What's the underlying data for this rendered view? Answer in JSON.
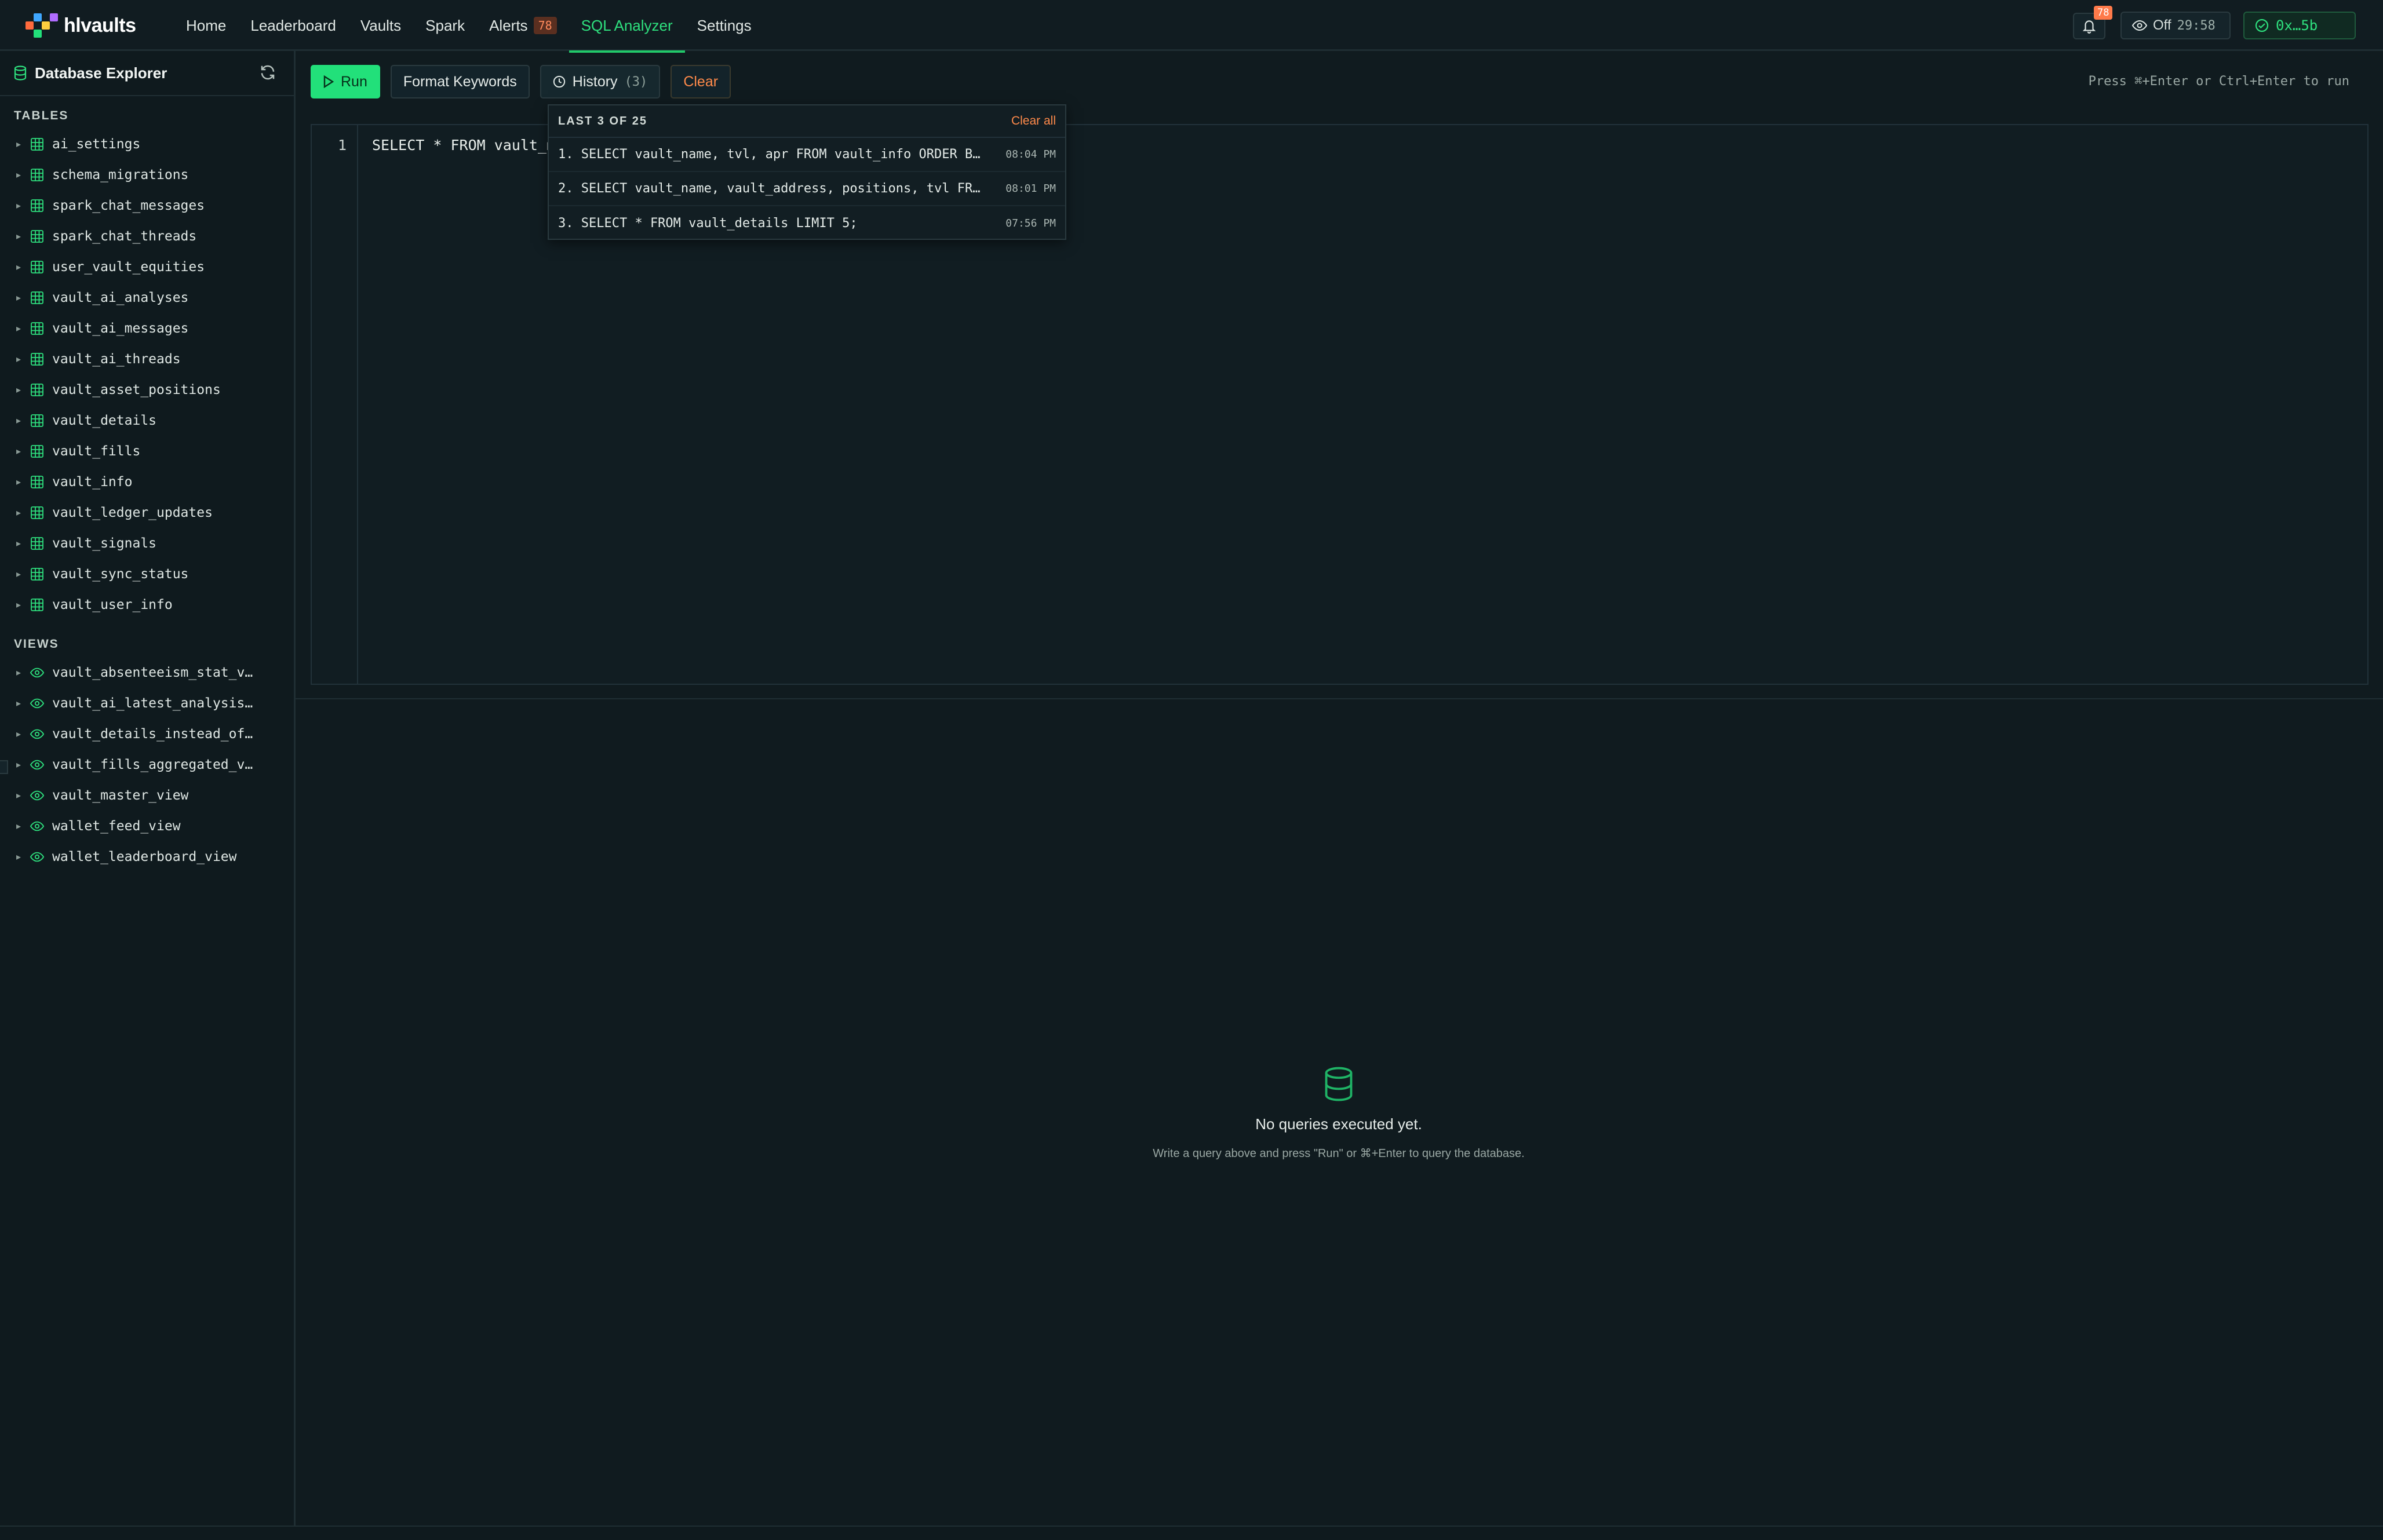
{
  "brand": {
    "name": "hlvaults"
  },
  "nav": {
    "items": [
      {
        "label": "Home"
      },
      {
        "label": "Leaderboard"
      },
      {
        "label": "Vaults"
      },
      {
        "label": "Spark"
      },
      {
        "label": "Alerts",
        "badge": "78"
      },
      {
        "label": "SQL Analyzer",
        "active": true
      },
      {
        "label": "Settings"
      }
    ]
  },
  "header_right": {
    "notifications_badge": "78",
    "watch_label": "Off",
    "watch_timer": "29:58",
    "wallet_label": "0x…5b"
  },
  "sidebar": {
    "title": "Database Explorer",
    "tables_heading": "TABLES",
    "tables": [
      "ai_settings",
      "schema_migrations",
      "spark_chat_messages",
      "spark_chat_threads",
      "user_vault_equities",
      "vault_ai_analyses",
      "vault_ai_messages",
      "vault_ai_threads",
      "vault_asset_positions",
      "vault_details",
      "vault_fills",
      "vault_info",
      "vault_ledger_updates",
      "vault_signals",
      "vault_sync_status",
      "vault_user_info"
    ],
    "views_heading": "VIEWS",
    "views": [
      "vault_absenteeism_stat_vi…",
      "vault_ai_latest_analysis_…",
      "vault_details_instead_of_…",
      "vault_fills_aggregated_vi…",
      "vault_master_view",
      "wallet_feed_view",
      "wallet_leaderboard_view"
    ]
  },
  "toolbar": {
    "run_label": "Run",
    "format_label": "Format Keywords",
    "history_label": "History",
    "history_count": "(3)",
    "clear_label": "Clear",
    "hint": "Press ⌘+Enter or Ctrl+Enter to run"
  },
  "editor": {
    "line_number": "1",
    "code": "SELECT * FROM vault_m"
  },
  "history": {
    "title": "LAST 3 OF 25",
    "clear_all": "Clear all",
    "entries": [
      {
        "query": "1. SELECT vault_name, tvl, apr FROM vault_info ORDER BY…",
        "time": "08:04 PM"
      },
      {
        "query": "2. SELECT vault_name, vault_address, positions, tvl FRO…",
        "time": "08:01 PM"
      },
      {
        "query": "3. SELECT * FROM vault_details LIMIT 5;",
        "time": "07:56 PM"
      }
    ]
  },
  "empty_state": {
    "title": "No queries executed yet.",
    "subtitle": "Write a query above and press \"Run\" or ⌘+Enter to query the database."
  },
  "colors": {
    "accent": "#22e07a",
    "warning": "#ff8a4a",
    "background": "#101b1f"
  }
}
